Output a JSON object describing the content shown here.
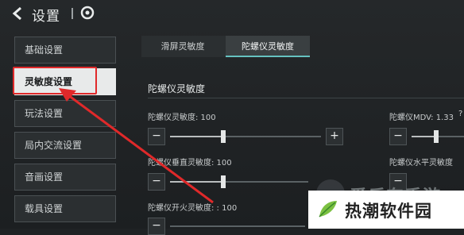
{
  "header": {
    "title": "设置"
  },
  "sidebar": {
    "items": [
      {
        "label": "基础设置"
      },
      {
        "label": "灵敏度设置"
      },
      {
        "label": "玩法设置"
      },
      {
        "label": "局内交流设置"
      },
      {
        "label": "音画设置"
      },
      {
        "label": "载具设置"
      }
    ]
  },
  "tabs": [
    {
      "label": "滑屏灵敏度"
    },
    {
      "label": "陀螺仪灵敏度"
    }
  ],
  "section": {
    "title": "陀螺仪灵敏度"
  },
  "sliders": {
    "gyro": {
      "label": "陀螺仪灵敏度: 100",
      "level": 0.42
    },
    "gyro_mdv": {
      "label": "陀螺仪MDV: 1.33",
      "help": "?"
    },
    "gyro_vertical": {
      "label": "陀螺仪垂直灵敏度: 100",
      "level": 0.42
    },
    "gyro_horizontal": {
      "label": "陀螺仪水平灵敏度"
    },
    "gyro_fire": {
      "label": "陀螺仪开火灵敏度: : 100"
    }
  },
  "buttons": {
    "minus": "−",
    "plus": "+"
  },
  "watermarks": {
    "a": "爱乐东手游",
    "b": "热潮软件园"
  },
  "colors": {
    "highlight": "#e0292a",
    "accent": "#66c2c0"
  }
}
